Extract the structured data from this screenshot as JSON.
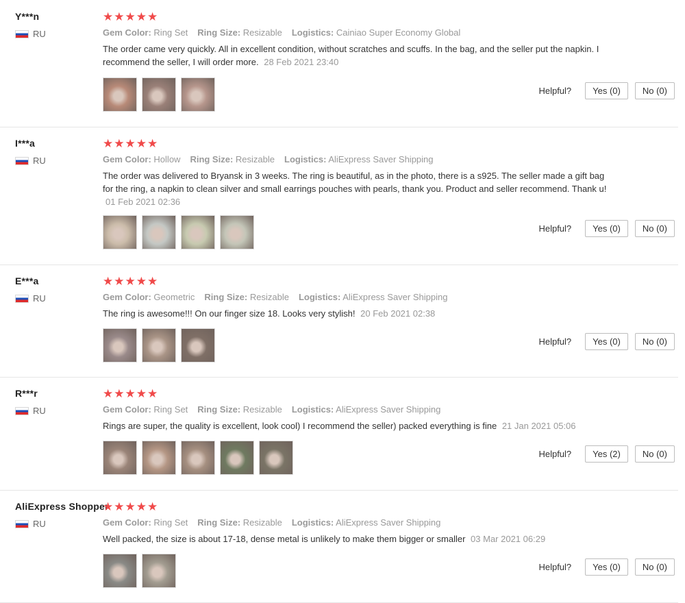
{
  "labels": {
    "gem_color": "Gem Color:",
    "ring_size": "Ring Size:",
    "logistics": "Logistics:",
    "helpful": "Helpful?",
    "stars": "★★★★★"
  },
  "colors": {
    "star": "#f04a4a",
    "divider": "#e6e6e6",
    "muted_text": "#999999",
    "body_text": "#333333"
  },
  "reviews": [
    {
      "user": "Y***n",
      "country": "RU",
      "gem_color": "Ring Set",
      "ring_size": "Resizable",
      "logistics": "Cainiao Super Economy Global",
      "text": "The order came very quickly. All in excellent condition, without scratches and scuffs. In the bag, and the seller put the napkin. I recommend the seller, I will order more.",
      "date": "28 Feb 2021 23:40",
      "yes": "Yes (0)",
      "no": "No (0)",
      "photos": [
        "#b88a78",
        "#9a8078",
        "#b6968c"
      ]
    },
    {
      "user": "I***a",
      "country": "RU",
      "gem_color": "Hollow",
      "ring_size": "Resizable",
      "logistics": "AliExpress Saver Shipping",
      "text": "The order was delivered to Bryansk in 3 weeks. The ring is beautiful, as in the photo, there is a s925. The seller made a gift bag for the ring, a napkin to clean silver and small earrings pouches with pearls, thank you. Product and seller recommend. Thank u!",
      "date": "01 Feb 2021 02:36",
      "yes": "Yes (0)",
      "no": "No (0)",
      "photos": [
        "#cbbcaa",
        "#c4c8c4",
        "#c7cab0",
        "#c4c6b8"
      ]
    },
    {
      "user": "E***a",
      "country": "RU",
      "gem_color": "Geometric",
      "ring_size": "Resizable",
      "logistics": "AliExpress Saver Shipping",
      "text": "The ring is awesome!!! On our finger size 18. Looks very stylish!",
      "date": "20 Feb 2021 02:38",
      "yes": "Yes (0)",
      "no": "No (0)",
      "photos": [
        "#9a8a8a",
        "#a99486",
        "#7f6f66"
      ]
    },
    {
      "user": "R***r",
      "country": "RU",
      "gem_color": "Ring Set",
      "ring_size": "Resizable",
      "logistics": "AliExpress Saver Shipping",
      "text": "Rings are super, the quality is excellent, look cool) I recommend the seller) packed everything is fine",
      "date": "21 Jan 2021 05:06",
      "yes": "Yes (2)",
      "no": "No (0)",
      "photos": [
        "#9a8478",
        "#b49684",
        "#a58f80",
        "#6f7a60",
        "#7a7466"
      ]
    },
    {
      "user": "AliExpress Shopper",
      "country": "RU",
      "gem_color": "Ring Set",
      "ring_size": "Resizable",
      "logistics": "AliExpress Saver Shipping",
      "text": "Well packed, the size is about 17-18, dense metal is unlikely to make them bigger or smaller",
      "date": "03 Mar 2021 06:29",
      "yes": "Yes (0)",
      "no": "No (0)",
      "photos": [
        "#8a8a86",
        "#a29c90"
      ]
    }
  ]
}
